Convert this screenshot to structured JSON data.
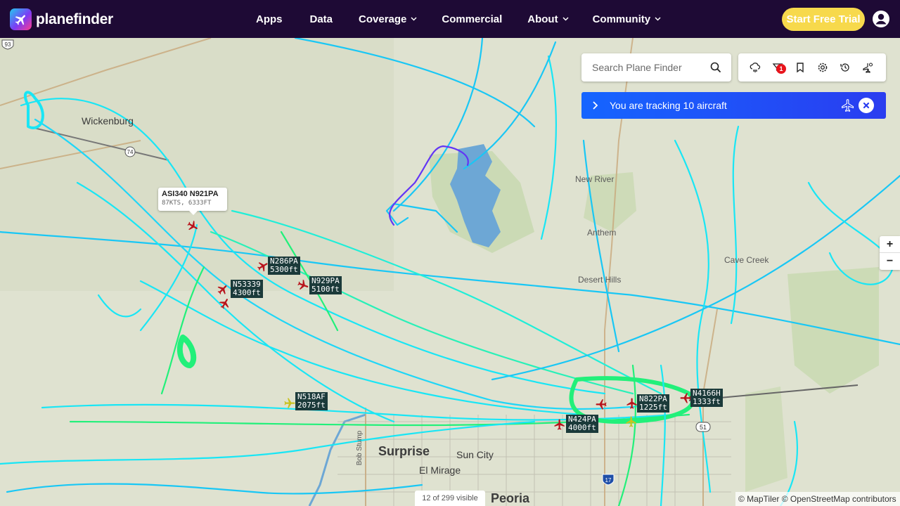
{
  "header": {
    "logo_text": "planefinder",
    "nav": [
      {
        "label": "Apps",
        "dropdown": false
      },
      {
        "label": "Data",
        "dropdown": false
      },
      {
        "label": "Coverage",
        "dropdown": true
      },
      {
        "label": "Commercial",
        "dropdown": false
      },
      {
        "label": "About",
        "dropdown": true
      },
      {
        "label": "Community",
        "dropdown": true
      }
    ],
    "trial_button": "Start Free Trial"
  },
  "search": {
    "placeholder": "Search Plane Finder"
  },
  "toolbar": {
    "icons": [
      "weather-icon",
      "filter-icon",
      "bookmark-icon",
      "settings-icon",
      "history-icon",
      "aircraft-settings-icon"
    ],
    "filter_badge": "1"
  },
  "tracking": {
    "text": "You are tracking 10 aircraft"
  },
  "zoom": {
    "in": "+",
    "out": "−"
  },
  "popup": {
    "title": "ASI340 N921PA",
    "subtitle": "87KTS, 6333FT"
  },
  "aircraft_labels": [
    {
      "callsign": "N286PA",
      "alt": "5300ft"
    },
    {
      "callsign": "N53339",
      "alt": "4300ft"
    },
    {
      "callsign": "N929PA",
      "alt": "5100ft"
    },
    {
      "callsign": "N518AF",
      "alt": "2075ft"
    },
    {
      "callsign": "N822PA",
      "alt": "1225ft"
    },
    {
      "callsign": "N4166H",
      "alt": "1333ft"
    },
    {
      "callsign": "N424PA",
      "alt": "4000ft"
    }
  ],
  "places": {
    "wickenburg": "Wickenburg",
    "new_river": "New River",
    "anthem": "Anthem",
    "desert_hills": "Desert Hills",
    "cave_creek": "Cave Creek",
    "surprise": "Surprise",
    "sun_city": "Sun City",
    "el_mirage": "El Mirage",
    "peoria": "Peoria",
    "bob_stump": "Bob Stump"
  },
  "shields": {
    "us93": "93",
    "r51": "51",
    "i17": "17",
    "s74": "74"
  },
  "status": {
    "visible": "12 of 299 visible"
  },
  "attribution": "© MapTiler © OpenStreetMap contributors",
  "colors": {
    "header_bg": "#1e0a35",
    "trial_btn": "#f7d94c",
    "track_cyan": "#19e6f5",
    "track_green": "#22f07a",
    "tracking_bar": "#1565ff"
  }
}
